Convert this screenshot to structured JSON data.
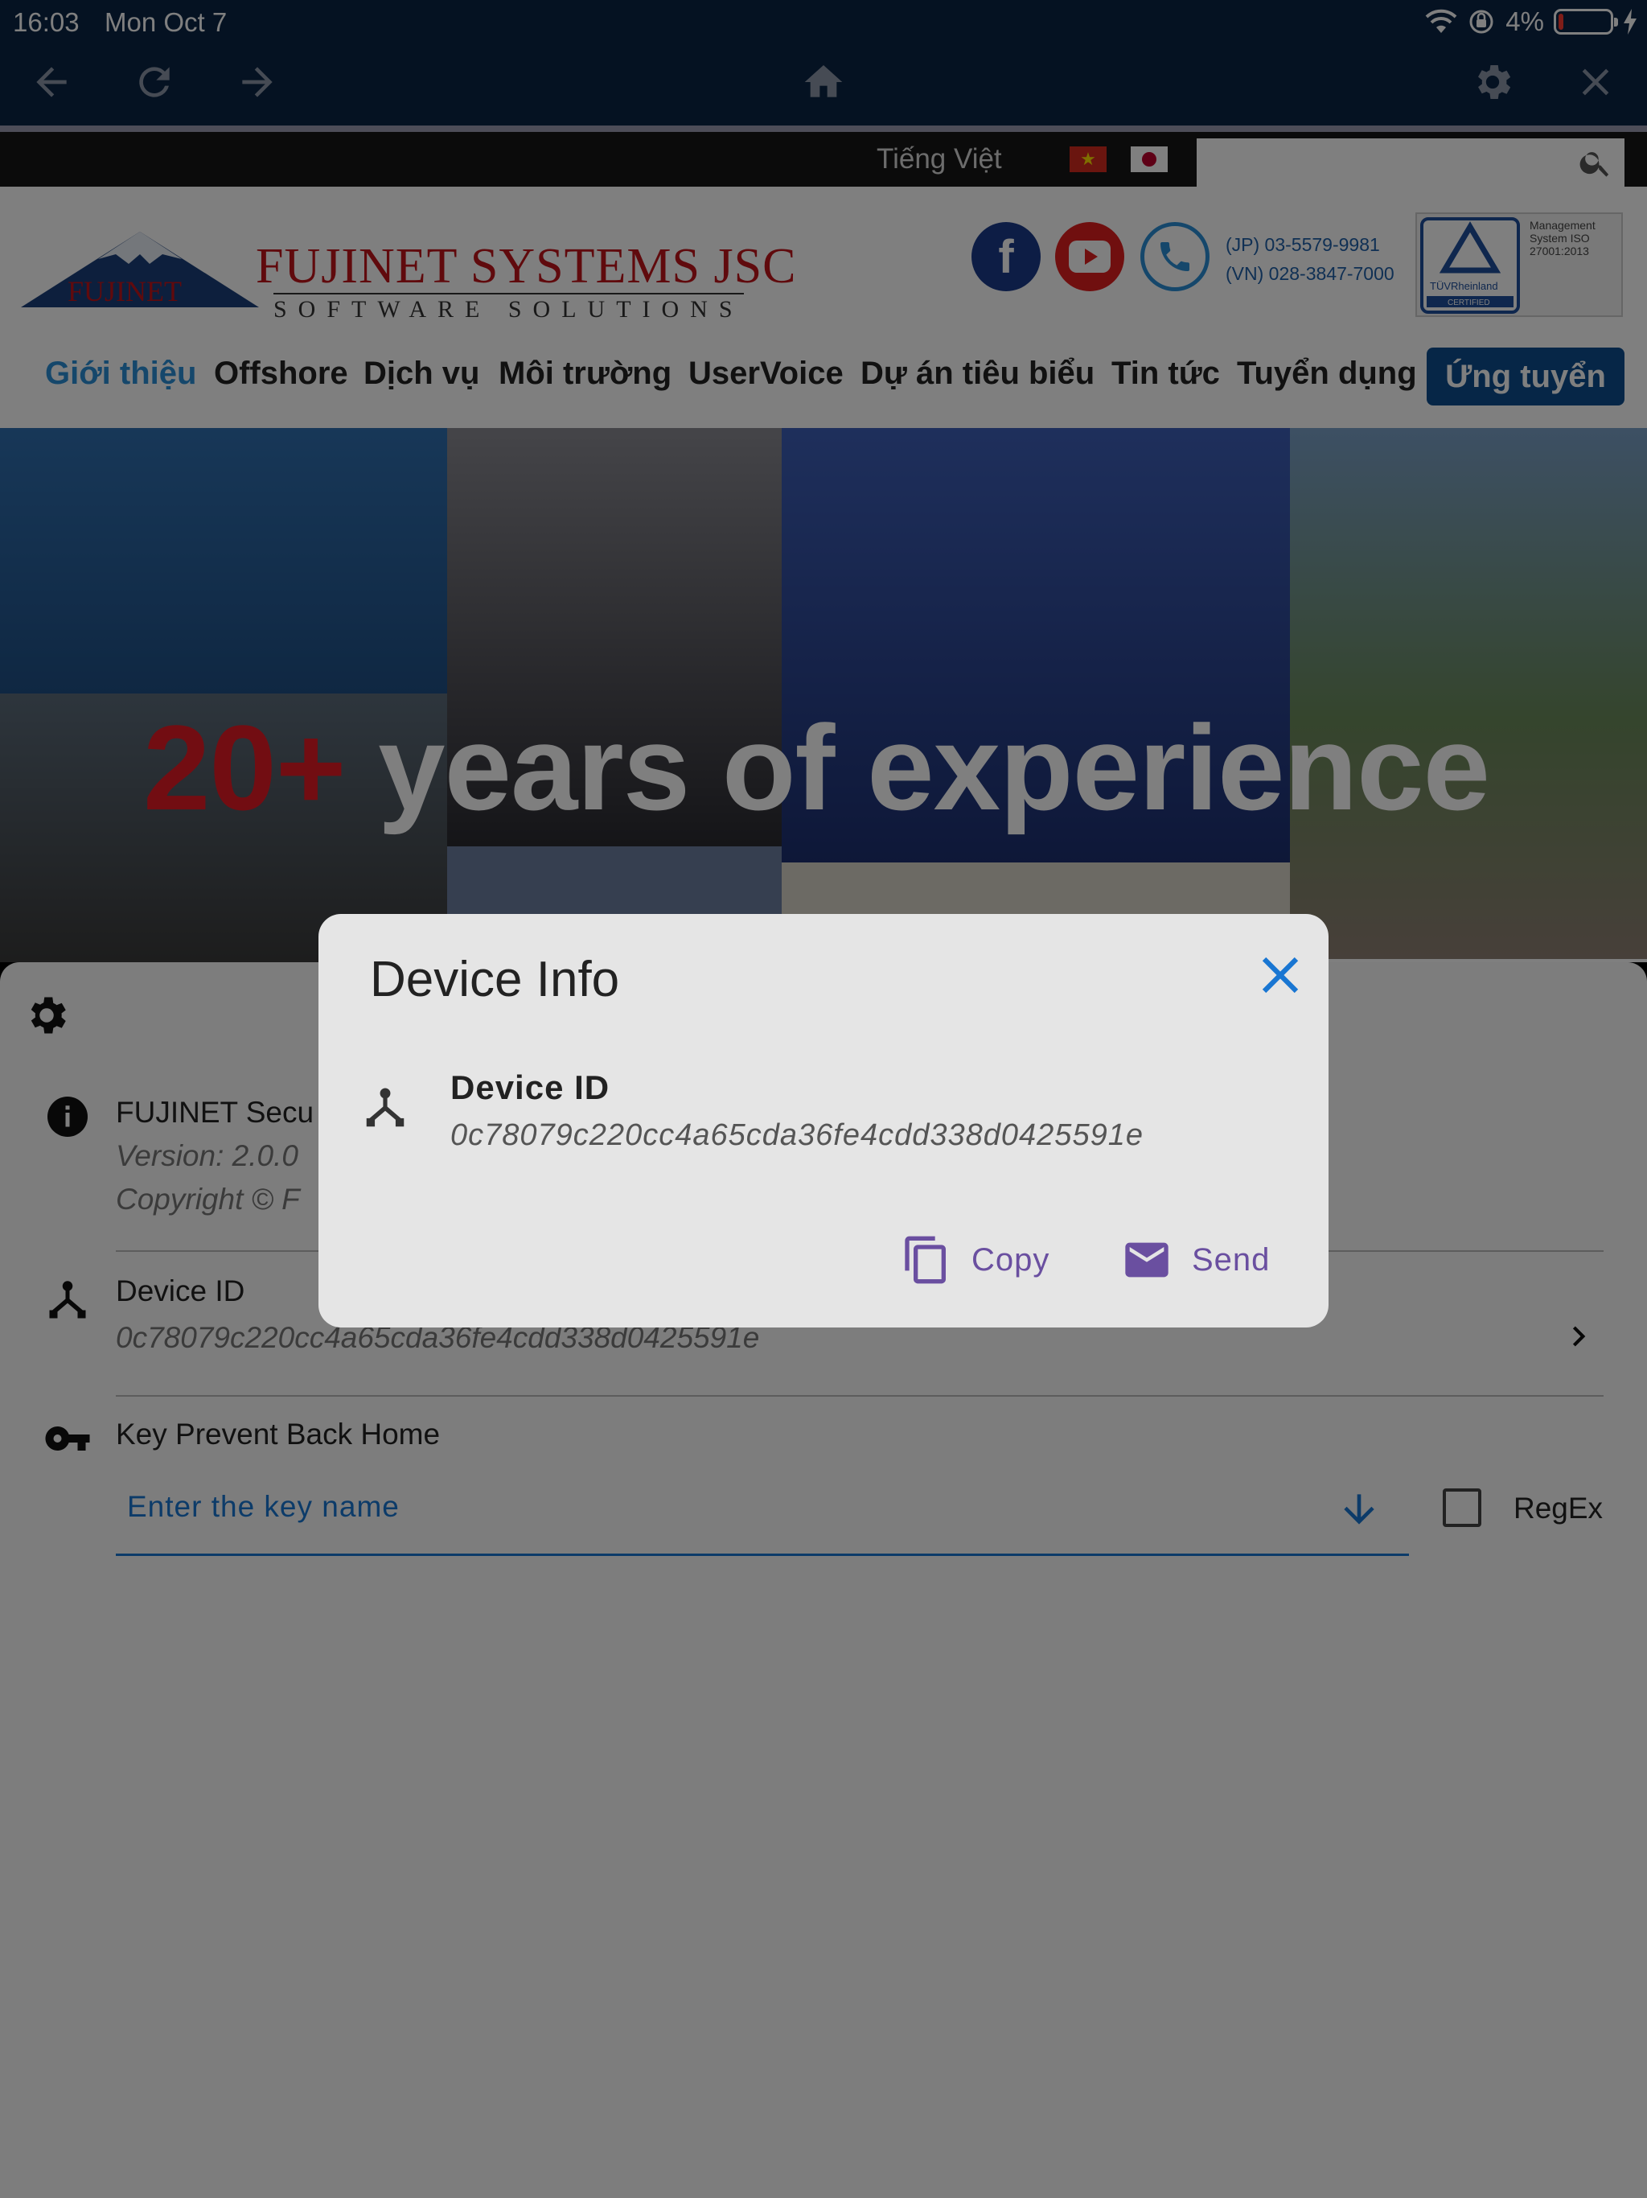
{
  "status_bar": {
    "time": "16:03",
    "date": "Mon Oct 7",
    "battery": "4%",
    "battery_level": 0.04
  },
  "toolbar": {
    "back_icon": "arrow-left-icon",
    "reload_icon": "reload-icon",
    "forward_icon": "arrow-right-icon",
    "home_icon": "home-icon",
    "settings_icon": "gear-icon",
    "close_icon": "close-icon"
  },
  "website": {
    "language": "Tiếng Việt",
    "flag_vn_star": "★",
    "company_name": "FUJINET SYSTEMS JSC",
    "tagline": "SOFTWARE SOLUTIONS",
    "logo_mark_text": "FUJINET",
    "phone_jp": "(JP) 03-5579-9981",
    "phone_vn": "(VN) 028-3847-7000",
    "tuv_text": "Management System ISO 27001:2013",
    "tuv_brand": "TÜVRheinland",
    "tuv_certified": "CERTIFIED",
    "nav": [
      "Giới thiệu",
      "Offshore",
      "Dịch vụ",
      "Môi trường",
      "UserVoice",
      "Dự án tiêu biểu",
      "Tin tức",
      "Tuyển dụng"
    ],
    "apply_button": "Ứng tuyển",
    "hero_number": "20+",
    "hero_text": "years of experience"
  },
  "app": {
    "app_name": "FUJINET Secu",
    "version": "Version: 2.0.0",
    "copyright": "Copyright © F",
    "device_id_label": "Device ID",
    "device_id_value": "0c78079c220cc4a65cda36fe4cdd338d0425591e",
    "key_label": "Key Prevent Back Home",
    "key_placeholder": "Enter the key name",
    "regex_label": "RegEx"
  },
  "dialog": {
    "title": "Device Info",
    "field_label": "Device ID",
    "field_value": "0c78079c220cc4a65cda36fe4cdd338d0425591e",
    "copy_label": "Copy",
    "send_label": "Send"
  },
  "colors": {
    "toolbar_bg": "#0b2445",
    "accent_blue": "#1976d2",
    "button_purple": "#6a4fa0",
    "dialog_bg": "#e5e5e5",
    "brand_red": "#c0151b"
  }
}
